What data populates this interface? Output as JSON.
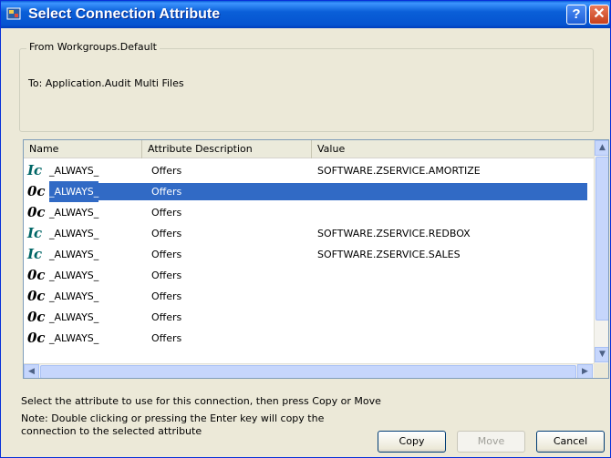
{
  "window": {
    "title": "Select Connection Attribute",
    "help_glyph": "?",
    "close_glyph": "✕"
  },
  "group": {
    "legend": "From Workgroups.Default",
    "to_text": "To: Application.Audit Multi Files"
  },
  "list": {
    "columns": [
      "Name",
      "Attribute Description",
      "Value"
    ],
    "rows": [
      {
        "icon": "attr-ic-icon",
        "icon_text": "Ic",
        "name": "_ALWAYS_",
        "desc": "Offers",
        "value": "SOFTWARE.ZSERVICE.AMORTIZE",
        "selected": false
      },
      {
        "icon": "attr-oc-icon",
        "icon_text": "0c",
        "name": "_ALWAYS_",
        "desc": "Offers",
        "value": "",
        "selected": true
      },
      {
        "icon": "attr-oc-icon",
        "icon_text": "0c",
        "name": "_ALWAYS_",
        "desc": "Offers",
        "value": "",
        "selected": false
      },
      {
        "icon": "attr-ic-icon",
        "icon_text": "Ic",
        "name": "_ALWAYS_",
        "desc": "Offers",
        "value": "SOFTWARE.ZSERVICE.REDBOX",
        "selected": false
      },
      {
        "icon": "attr-ic-icon",
        "icon_text": "Ic",
        "name": "_ALWAYS_",
        "desc": "Offers",
        "value": "SOFTWARE.ZSERVICE.SALES",
        "selected": false
      },
      {
        "icon": "attr-oc-icon",
        "icon_text": "0c",
        "name": "_ALWAYS_",
        "desc": "Offers",
        "value": "",
        "selected": false
      },
      {
        "icon": "attr-oc-icon",
        "icon_text": "0c",
        "name": "_ALWAYS_",
        "desc": "Offers",
        "value": "",
        "selected": false
      },
      {
        "icon": "attr-oc-icon",
        "icon_text": "0c",
        "name": "_ALWAYS_",
        "desc": "Offers",
        "value": "",
        "selected": false
      },
      {
        "icon": "attr-oc-icon",
        "icon_text": "0c",
        "name": "_ALWAYS_",
        "desc": "Offers",
        "value": "",
        "selected": false
      }
    ]
  },
  "instructions": "Select the attribute to use for this connection, then press Copy or Move",
  "note_line1": "Note: Double clicking or pressing the Enter key will copy the",
  "note_line2": "connection to the selected attribute",
  "buttons": {
    "copy": "Copy",
    "move": "Move",
    "cancel": "Cancel"
  },
  "colors": {
    "titlebar": "#0a5fd8",
    "selection": "#316ac5",
    "dialog_bg": "#ece9d8"
  }
}
